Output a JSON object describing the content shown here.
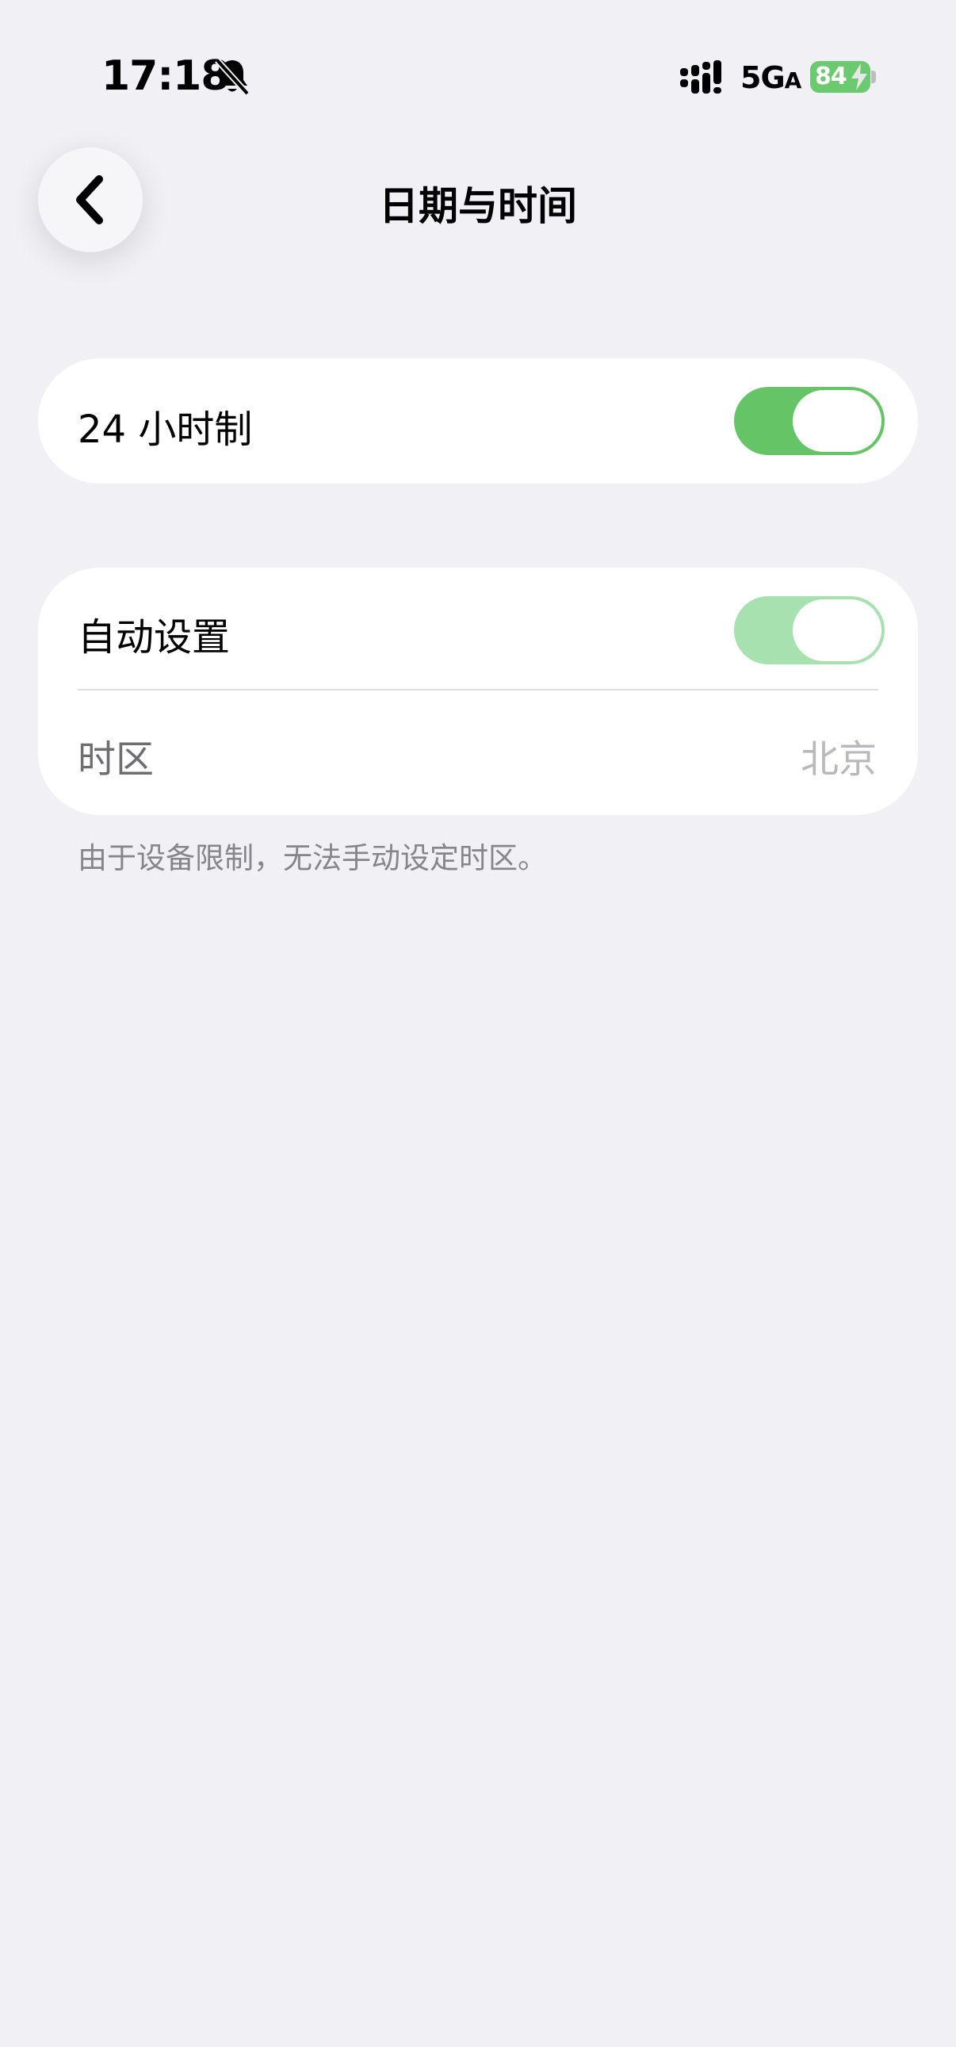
{
  "status_bar": {
    "time": "17:18",
    "network": "5G",
    "network_suffix": "A",
    "battery": "84",
    "icons": [
      "bell-muted-icon",
      "signal-icon",
      "charging-bolt-icon"
    ]
  },
  "header": {
    "title": "日期与时间",
    "back_icon": "chevron-left-icon"
  },
  "settings": {
    "hour24": {
      "label": "24 小时制",
      "toggle_on": true
    },
    "auto_set": {
      "label": "自动设置",
      "toggle_on": true,
      "enabled": false
    },
    "timezone": {
      "label": "时区",
      "value": "北京"
    },
    "footnote": "由于设备限制，无法手动设定时区。"
  },
  "colors": {
    "background": "#f1f0f5",
    "toggle_on": "#65c466",
    "toggle_disabled": "#a8e1b0",
    "battery": "#6bc96f"
  }
}
